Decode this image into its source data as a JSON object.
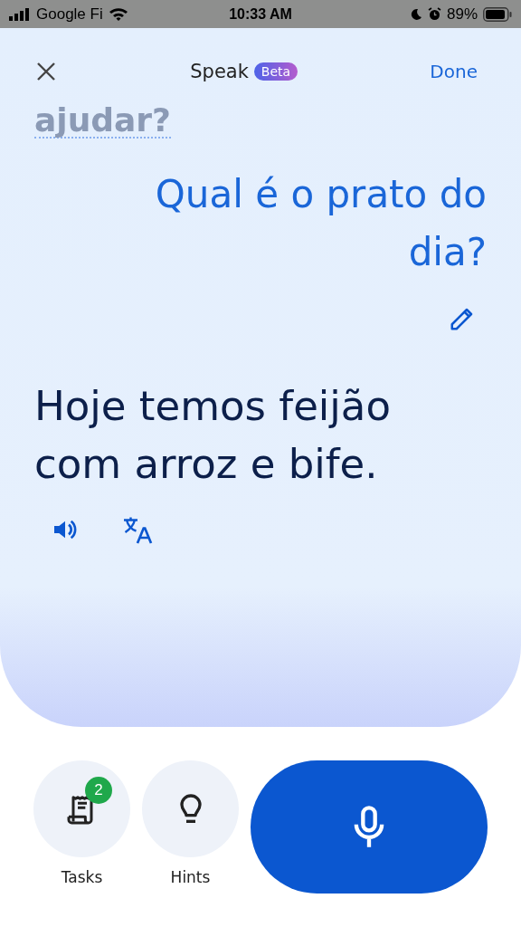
{
  "status_bar": {
    "carrier": "Google Fi",
    "time": "10:33 AM",
    "battery": "89%"
  },
  "header": {
    "title": "Speak",
    "badge": "Beta",
    "done": "Done"
  },
  "previous_text": "ajudar?",
  "question": "Qual é o prato do dia?",
  "answer": "Hoje temos feijão com arroz e bife.",
  "actions": [
    {
      "label": "Tasks",
      "kind": "tasks",
      "badge": "2"
    },
    {
      "label": "Hints",
      "kind": "hints"
    }
  ]
}
